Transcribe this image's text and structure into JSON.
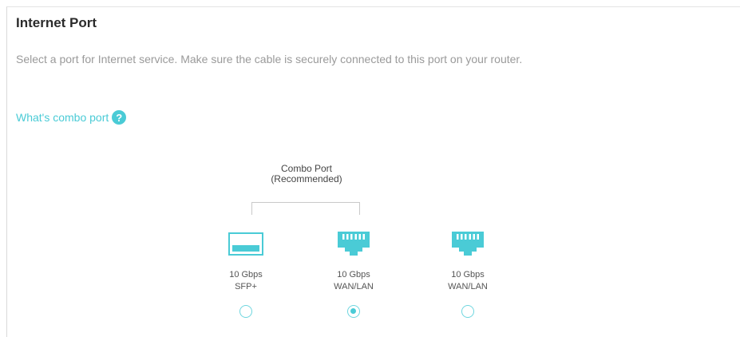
{
  "section": {
    "title": "Internet Port",
    "description": "Select a port for Internet service. Make sure the cable is securely connected to this port on your router.",
    "help_link": "What's combo port",
    "help_icon": "question-circle-icon"
  },
  "combo": {
    "label_line1": "Combo Port",
    "label_line2": "(Recommended)"
  },
  "ports": [
    {
      "icon": "sfp-port-icon",
      "line1": "10 Gbps",
      "line2": "SFP+",
      "selected": false
    },
    {
      "icon": "ethernet-port-icon",
      "line1": "10 Gbps",
      "line2": "WAN/LAN",
      "selected": true
    },
    {
      "icon": "ethernet-port-icon",
      "line1": "10 Gbps",
      "line2": "WAN/LAN",
      "selected": false
    }
  ],
  "colors": {
    "accent": "#4acbd6",
    "text_muted": "#9a9a9a"
  }
}
